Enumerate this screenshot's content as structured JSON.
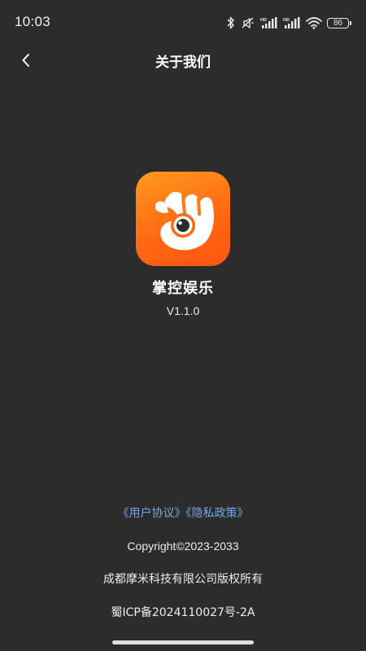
{
  "status_bar": {
    "time": "10:03",
    "battery_level": "86",
    "icons": [
      "bluetooth-icon",
      "mute-icon",
      "signal-hd-icon",
      "signal-hd-icon",
      "wifi-icon",
      "battery-icon"
    ]
  },
  "header": {
    "title": "关于我们",
    "back_icon": "chevron-left-icon"
  },
  "app": {
    "name": "掌控娱乐",
    "version": "V1.1.0",
    "logo_icon": "hand-eye-logo-icon"
  },
  "footer": {
    "user_agreement": "《用户协议》",
    "privacy_policy": "《隐私政策》",
    "copyright": "Copyright©2023-2033",
    "company": "成都摩米科技有限公司版权所有",
    "icp": "蜀ICP备2024110027号-2A"
  },
  "colors": {
    "background": "#2c2c2c",
    "link": "#6fa8e8",
    "logo_orange": "#ff6a12"
  }
}
